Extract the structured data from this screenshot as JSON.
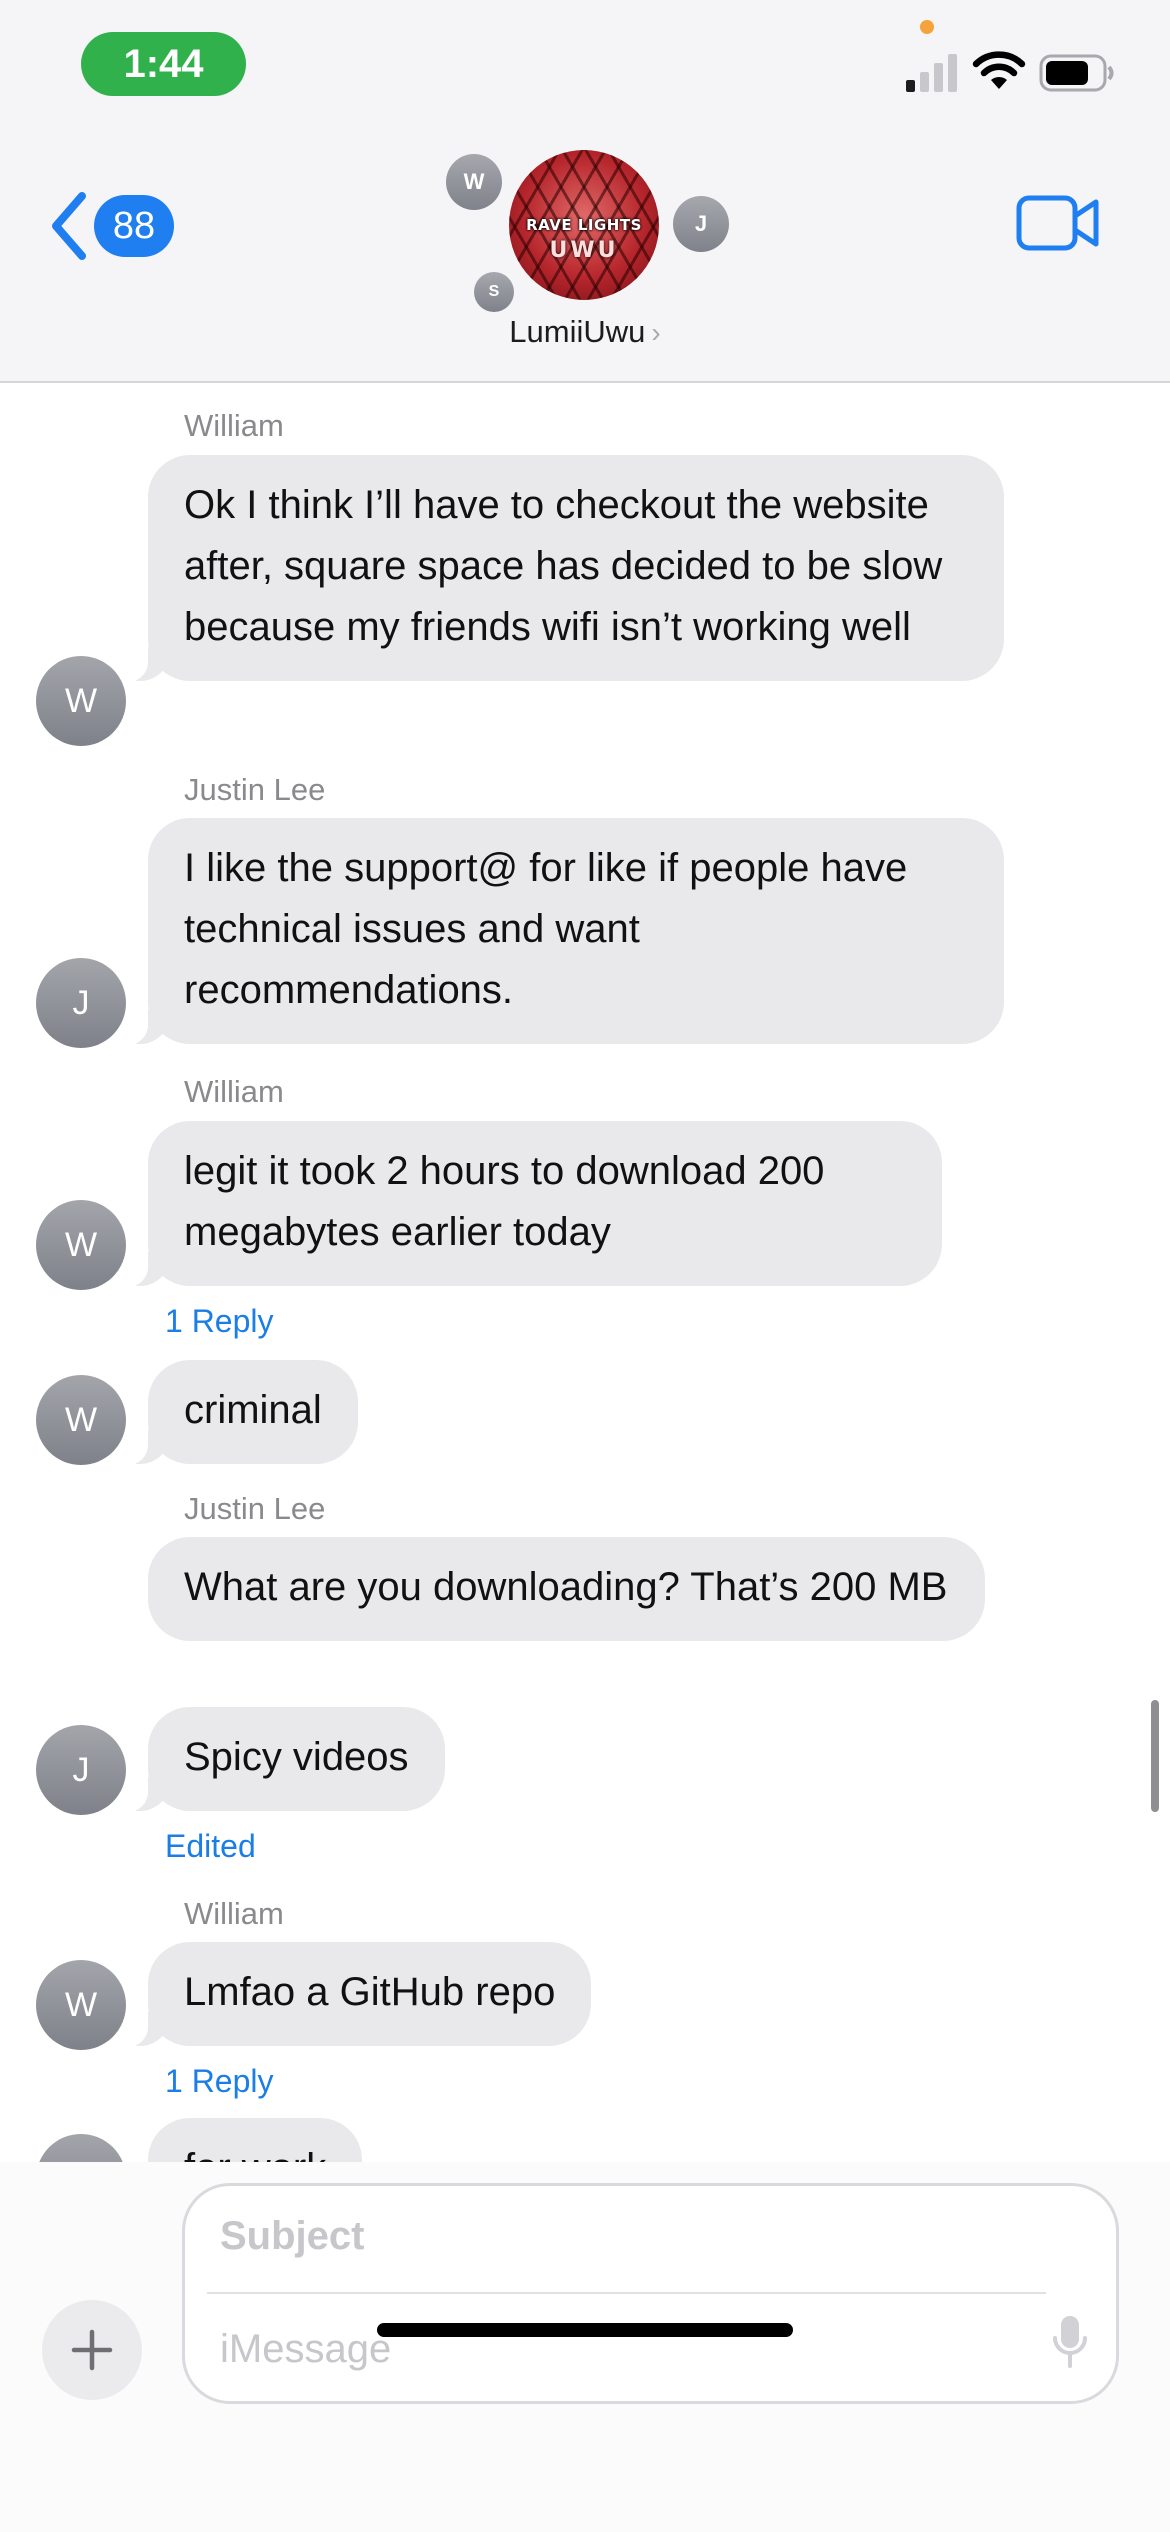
{
  "status_bar": {
    "time": "1:44"
  },
  "header": {
    "back_count": "88",
    "group_name": "LumiiUwu",
    "chevron": "›",
    "participant_initials": [
      "W",
      "J",
      "S"
    ],
    "group_photo_text": [
      "RAVE LIGHTS",
      "UWU"
    ]
  },
  "messages": [
    {
      "sender": "William",
      "avatar": "W",
      "text": "Ok I think I’ll have to checkout the website after, square space has decided to be slow because my friends wifi isn’t working well"
    },
    {
      "sender": "Justin Lee",
      "avatar": "J",
      "text": "I like the support@ for like if people have technical issues and want recommendations."
    },
    {
      "sender": "William",
      "avatar": "W",
      "text": "legit it took 2 hours to download 200 megabytes earlier today",
      "meta": "1 Reply"
    },
    {
      "avatar": "W",
      "text": "criminal"
    },
    {
      "sender": "Justin Lee",
      "text": "What are you downloading? That’s 200 MB"
    },
    {
      "avatar": "J",
      "text": "Spicy videos",
      "meta": "Edited"
    },
    {
      "sender": "William",
      "avatar": "W",
      "text": "Lmfao a GitHub repo",
      "meta": "1 Reply"
    },
    {
      "avatar": "W",
      "text": "for work"
    }
  ],
  "compose": {
    "subject_placeholder": "Subject",
    "message_placeholder": "iMessage"
  },
  "colors": {
    "accent": "#1f7ff0",
    "time_pill": "#30b14c",
    "bubble": "#e9e9eb",
    "link": "#1a7ee6"
  },
  "icons": [
    "back-chevron-icon",
    "video-camera-icon",
    "plus-icon",
    "microphone-icon",
    "signal-icon",
    "wifi-icon",
    "battery-icon"
  ]
}
